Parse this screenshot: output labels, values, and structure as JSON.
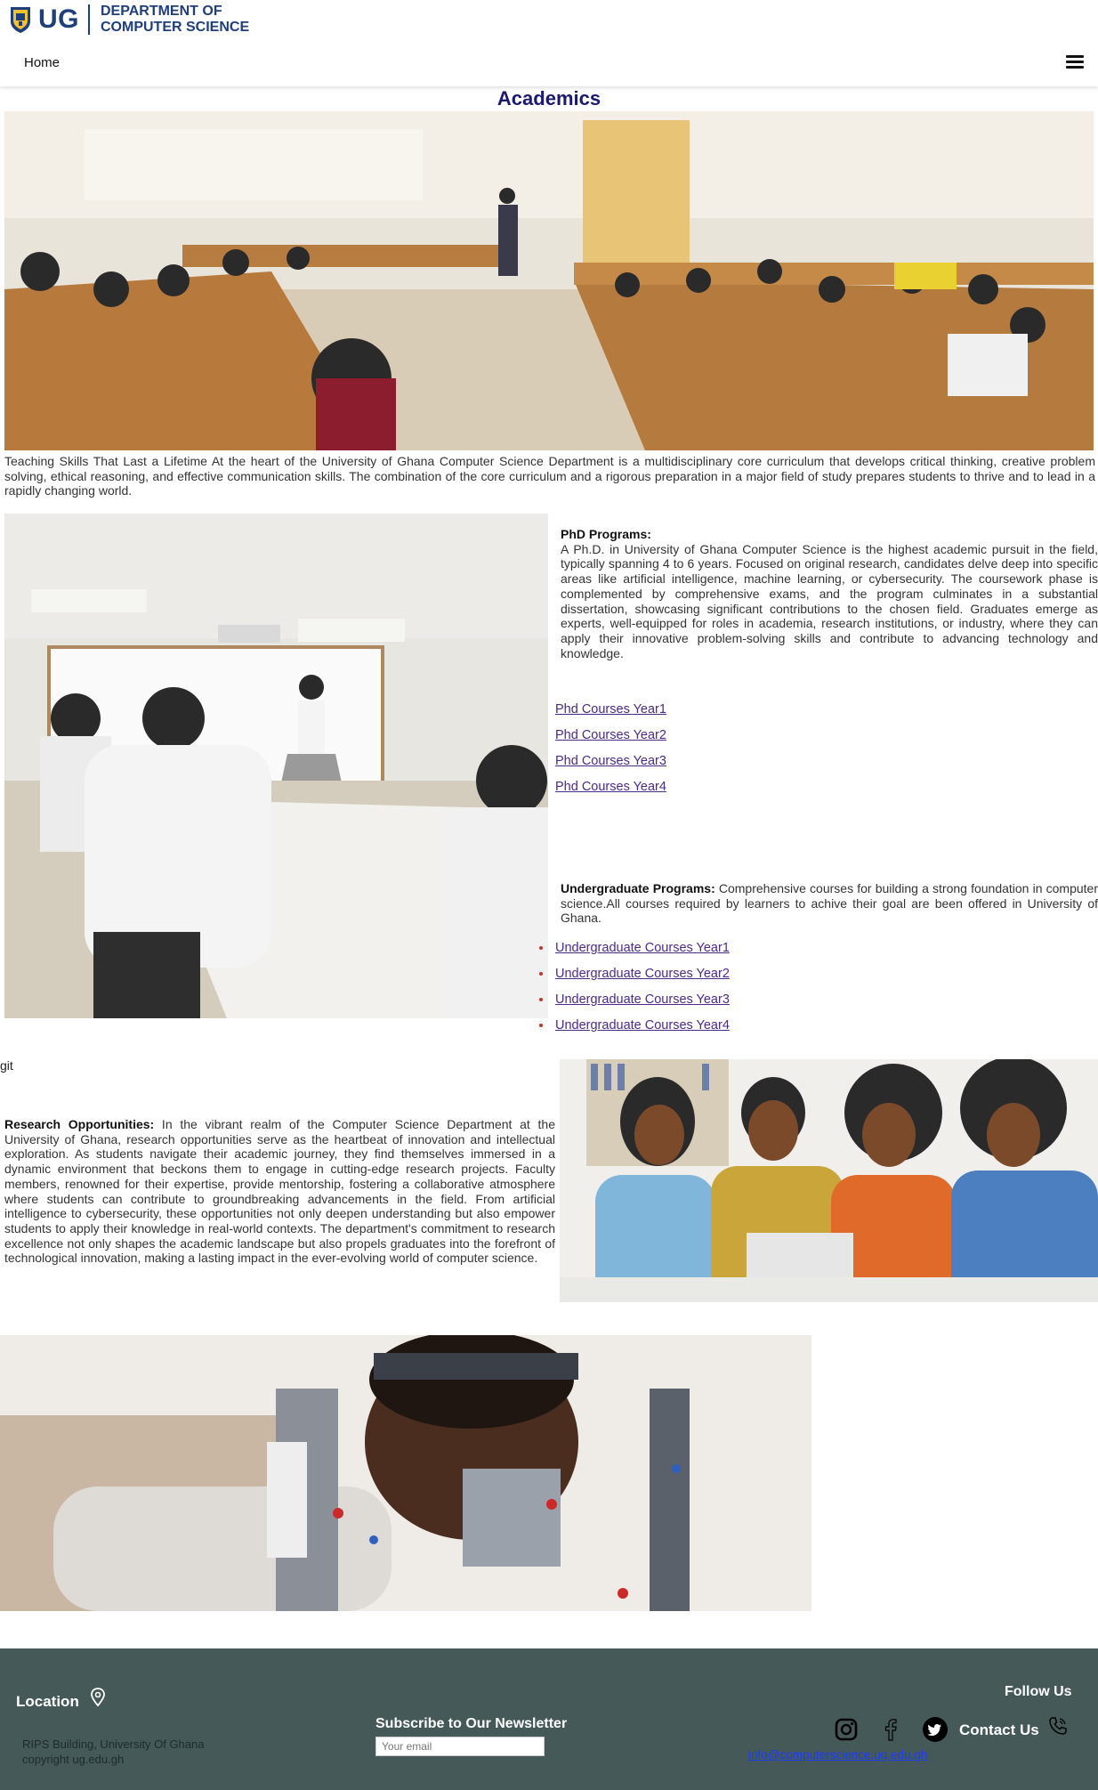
{
  "header": {
    "logo_ug": "UG",
    "logo_line1": "DEPARTMENT OF",
    "logo_line2": "COMPUTER SCIENCE",
    "nav_home": "Home"
  },
  "page": {
    "title": "Academics",
    "intro": "Teaching Skills That Last a Lifetime At the heart of the University of Ghana Computer Science Department is a multidisciplinary core curriculum that develops critical thinking, creative problem solving, ethical reasoning, and effective communication skills. The combination of the core curriculum and a rigorous preparation in a major field of study prepares students to thrive and to lead in a rapidly changing world."
  },
  "phd": {
    "heading": "PhD Programs:",
    "text": "A Ph.D. in University of Ghana Computer Science is the highest academic pursuit in the field, typically spanning 4 to 6 years. Focused on original research, candidates delve deep into specific areas like artificial intelligence, machine learning, or cybersecurity. The coursework phase is complemented by comprehensive exams, and the program culminates in a substantial dissertation, showcasing significant contributions to the chosen field. Graduates emerge as experts, well-equipped for roles in academia, research institutions, or industry, where they can apply their innovative problem-solving skills and contribute to advancing technology and knowledge.",
    "links": [
      "Phd Courses Year1",
      "Phd Courses Year2",
      "Phd Courses Year3",
      "Phd Courses Year4"
    ]
  },
  "undergrad": {
    "heading": "Undergraduate Programs:",
    "text": " Comprehensive courses for building a strong foundation in computer science.All courses required by learners to achive their goal are been offered in University of Ghana.",
    "links": [
      "Undergraduate Courses Year1",
      "Undergraduate Courses Year2",
      "Undergraduate Courses Year3",
      "Undergraduate Courses Year4"
    ]
  },
  "stray_text": "git",
  "research": {
    "heading": "Research Opportunities:",
    "text": " In the vibrant realm of the Computer Science Department at the University of Ghana, research opportunities serve as the heartbeat of innovation and intellectual exploration. As students navigate their academic journey, they find themselves immersed in a dynamic environment that beckons them to engage in cutting-edge research projects. Faculty members, renowned for their expertise, provide mentorship, fostering a collaborative atmosphere where students can contribute to groundbreaking advancements in the field. From artificial intelligence to cybersecurity, these opportunities not only deepen understanding but also empower students to apply their knowledge in real-world contexts. The department's commitment to research excellence not only shapes the academic landscape but also propels graduates into the forefront of technological innovation, making a lasting impact in the ever-evolving world of computer science."
  },
  "footer": {
    "location_title": "Location",
    "address": "RIPS Building, University Of Ghana",
    "copyright": "copyright ug.edu.gh",
    "newsletter_title": "Subscribe to Our Newsletter",
    "email_placeholder": "Your email",
    "follow_title": "Follow Us",
    "contact_title": "Contact Us",
    "contact_email": "info@computerscience.ug.edu.gh"
  },
  "colors": {
    "title": "#1a1a6e",
    "link": "#4c2a85",
    "footer_bg": "#455958",
    "brand": "#1f3f7a"
  }
}
